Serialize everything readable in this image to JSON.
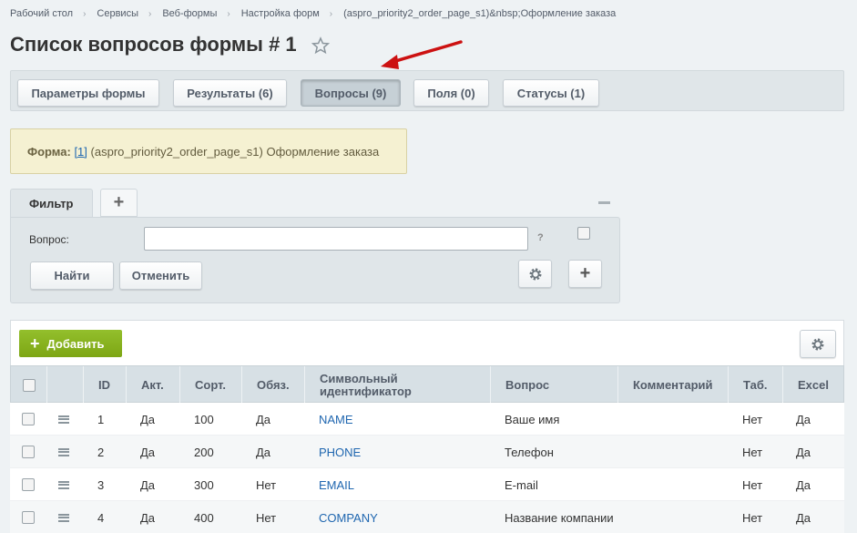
{
  "breadcrumb": [
    "Рабочий стол",
    "Сервисы",
    "Веб-формы",
    "Настройка форм",
    "(aspro_priority2_order_page_s1)&nbsp;Оформление заказа"
  ],
  "title": "Список вопросов формы # 1",
  "tabs": [
    "Параметры формы",
    "Результаты (6)",
    "Вопросы (9)",
    "Поля (0)",
    "Статусы (1)"
  ],
  "active_tab": "Вопросы (9)",
  "form_info": {
    "label": "Форма:",
    "link": "[1]",
    "text": "(aspro_priority2_order_page_s1) Оформление заказа"
  },
  "filter": {
    "tab_label": "Фильтр",
    "add_tab": "+",
    "field_label": "Вопрос:",
    "help": "?",
    "find_button": "Найти",
    "cancel_button": "Отменить"
  },
  "toolbar": {
    "add_button": "Добавить"
  },
  "columns": [
    "ID",
    "Акт.",
    "Сорт.",
    "Обяз.",
    "Символьный идентификатор",
    "Вопрос",
    "Комментарий",
    "Таб.",
    "Excel"
  ],
  "rows": [
    {
      "id": "1",
      "active": "Да",
      "sort": "100",
      "required": "Да",
      "code": "NAME",
      "question": "Ваше имя",
      "comment": "",
      "tab": "Нет",
      "excel": "Да"
    },
    {
      "id": "2",
      "active": "Да",
      "sort": "200",
      "required": "Да",
      "code": "PHONE",
      "question": "Телефон",
      "comment": "",
      "tab": "Нет",
      "excel": "Да"
    },
    {
      "id": "3",
      "active": "Да",
      "sort": "300",
      "required": "Нет",
      "code": "EMAIL",
      "question": "E-mail",
      "comment": "",
      "tab": "Нет",
      "excel": "Да"
    },
    {
      "id": "4",
      "active": "Да",
      "sort": "400",
      "required": "Нет",
      "code": "COMPANY",
      "question": "Название компании",
      "comment": "",
      "tab": "Нет",
      "excel": "Да"
    }
  ],
  "colors": {
    "accent_green": "#86b31f",
    "link_blue": "#2067b0",
    "annotation_arrow": "#cc1111"
  }
}
